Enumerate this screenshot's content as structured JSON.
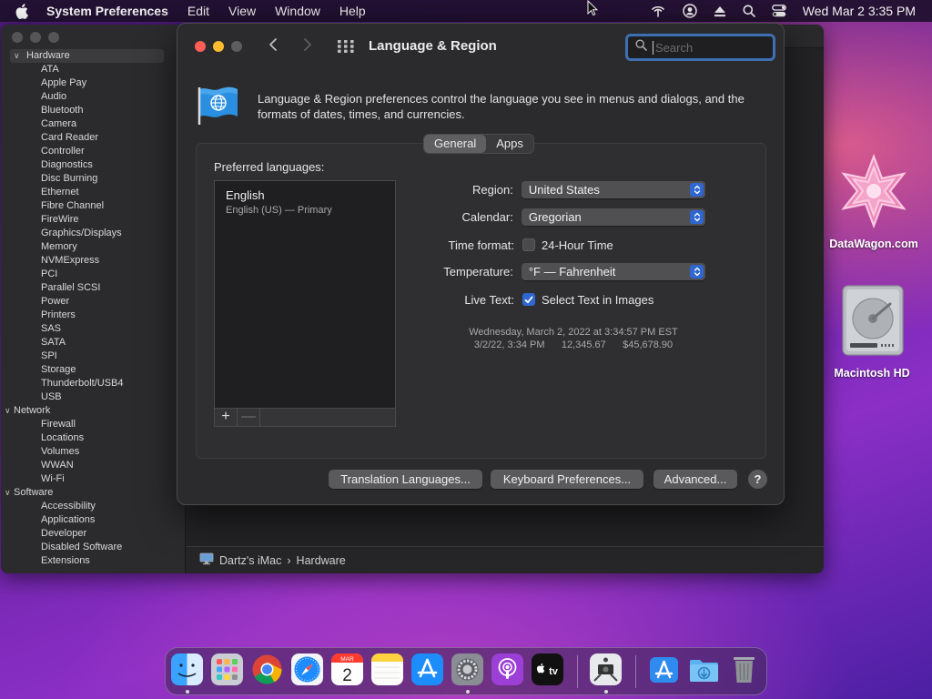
{
  "menubar": {
    "app_name": "System Preferences",
    "menus": [
      "Edit",
      "View",
      "Window",
      "Help"
    ],
    "clock": "Wed Mar 2  3:35 PM"
  },
  "sysinfo": {
    "tree": [
      {
        "type": "section",
        "label": "Hardware",
        "selected": true
      },
      {
        "type": "child",
        "label": "ATA"
      },
      {
        "type": "child",
        "label": "Apple Pay"
      },
      {
        "type": "child",
        "label": "Audio"
      },
      {
        "type": "child",
        "label": "Bluetooth"
      },
      {
        "type": "child",
        "label": "Camera"
      },
      {
        "type": "child",
        "label": "Card Reader"
      },
      {
        "type": "child",
        "label": "Controller"
      },
      {
        "type": "child",
        "label": "Diagnostics"
      },
      {
        "type": "child",
        "label": "Disc Burning"
      },
      {
        "type": "child",
        "label": "Ethernet"
      },
      {
        "type": "child",
        "label": "Fibre Channel"
      },
      {
        "type": "child",
        "label": "FireWire"
      },
      {
        "type": "child",
        "label": "Graphics/Displays"
      },
      {
        "type": "child",
        "label": "Memory"
      },
      {
        "type": "child",
        "label": "NVMExpress"
      },
      {
        "type": "child",
        "label": "PCI"
      },
      {
        "type": "child",
        "label": "Parallel SCSI"
      },
      {
        "type": "child",
        "label": "Power"
      },
      {
        "type": "child",
        "label": "Printers"
      },
      {
        "type": "child",
        "label": "SAS"
      },
      {
        "type": "child",
        "label": "SATA"
      },
      {
        "type": "child",
        "label": "SPI"
      },
      {
        "type": "child",
        "label": "Storage"
      },
      {
        "type": "child",
        "label": "Thunderbolt/USB4"
      },
      {
        "type": "child",
        "label": "USB"
      },
      {
        "type": "section",
        "label": "Network"
      },
      {
        "type": "child",
        "label": "Firewall"
      },
      {
        "type": "child",
        "label": "Locations"
      },
      {
        "type": "child",
        "label": "Volumes"
      },
      {
        "type": "child",
        "label": "WWAN"
      },
      {
        "type": "child",
        "label": "Wi-Fi"
      },
      {
        "type": "section",
        "label": "Software"
      },
      {
        "type": "child",
        "label": "Accessibility"
      },
      {
        "type": "child",
        "label": "Applications"
      },
      {
        "type": "child",
        "label": "Developer"
      },
      {
        "type": "child",
        "label": "Disabled Software"
      },
      {
        "type": "child",
        "label": "Extensions"
      }
    ],
    "path": {
      "computer": "Dartz's iMac",
      "separator": "›",
      "section": "Hardware"
    }
  },
  "prefs": {
    "title": "Language & Region",
    "search_placeholder": "Search",
    "description": "Language & Region preferences control the language you see in menus and dialogs, and the formats of dates, times, and currencies.",
    "tabs": [
      {
        "label": "General",
        "active": true
      },
      {
        "label": "Apps",
        "active": false
      }
    ],
    "preferred_languages_label": "Preferred languages:",
    "languages": [
      {
        "name": "English",
        "detail": "English (US) — Primary"
      }
    ],
    "add_symbol": "+",
    "remove_symbol": "—",
    "region": {
      "label": "Region:",
      "value": "United States"
    },
    "calendar": {
      "label": "Calendar:",
      "value": "Gregorian"
    },
    "time_format": {
      "label": "Time format:",
      "option": "24-Hour Time",
      "checked": false
    },
    "temperature": {
      "label": "Temperature:",
      "value": "°F — Fahrenheit"
    },
    "live_text": {
      "label": "Live Text:",
      "option": "Select Text in Images",
      "checked": true
    },
    "sample_line1": "Wednesday, March 2, 2022 at 3:34:57 PM EST",
    "sample_line2": "3/2/22, 3:34 PM      12,345.67      $45,678.90",
    "buttons": {
      "translation": "Translation Languages...",
      "keyboard": "Keyboard Preferences...",
      "advanced": "Advanced...",
      "help": "?"
    }
  },
  "desktop": {
    "logo_label": "DataWagon.com",
    "drive_label": "Macintosh HD"
  },
  "dock": {
    "calendar_month": "MAR",
    "calendar_day": "2",
    "tv_label": "tv",
    "colors": {
      "accent": "#2f66d0",
      "close": "#ff5f57",
      "minimize": "#febc2e"
    }
  }
}
